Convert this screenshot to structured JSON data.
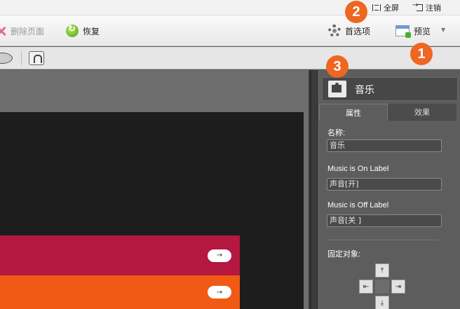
{
  "topbar": {
    "fullscreen_label": "全屏",
    "logout_label": "注销"
  },
  "toolbar": {
    "delete_page_label": "删除页面",
    "restore_label": "恢复",
    "preferences_label": "首选项",
    "preview_label": "预览"
  },
  "badges": {
    "one": "1",
    "two": "2",
    "three": "3"
  },
  "panel": {
    "title": "音乐",
    "tabs": [
      {
        "label": "属性"
      },
      {
        "label": "效果"
      }
    ],
    "name_label": "名称:",
    "name_value": "音乐",
    "on_label_caption": "Music is On Label",
    "on_label_value": "声音[开]",
    "off_label_caption": "Music is Off Label",
    "off_label_value": "声音[关 ]",
    "pin_label": "固定对象:"
  },
  "anchor": {
    "top": "⤒",
    "left": "⇤",
    "right": "⇥",
    "bottom": "⤓"
  },
  "stage": {
    "row_arrow": "→"
  },
  "colors": {
    "badge": "#ee6622",
    "row_primary": "#b4173f",
    "row_secondary": "#f05a14"
  }
}
